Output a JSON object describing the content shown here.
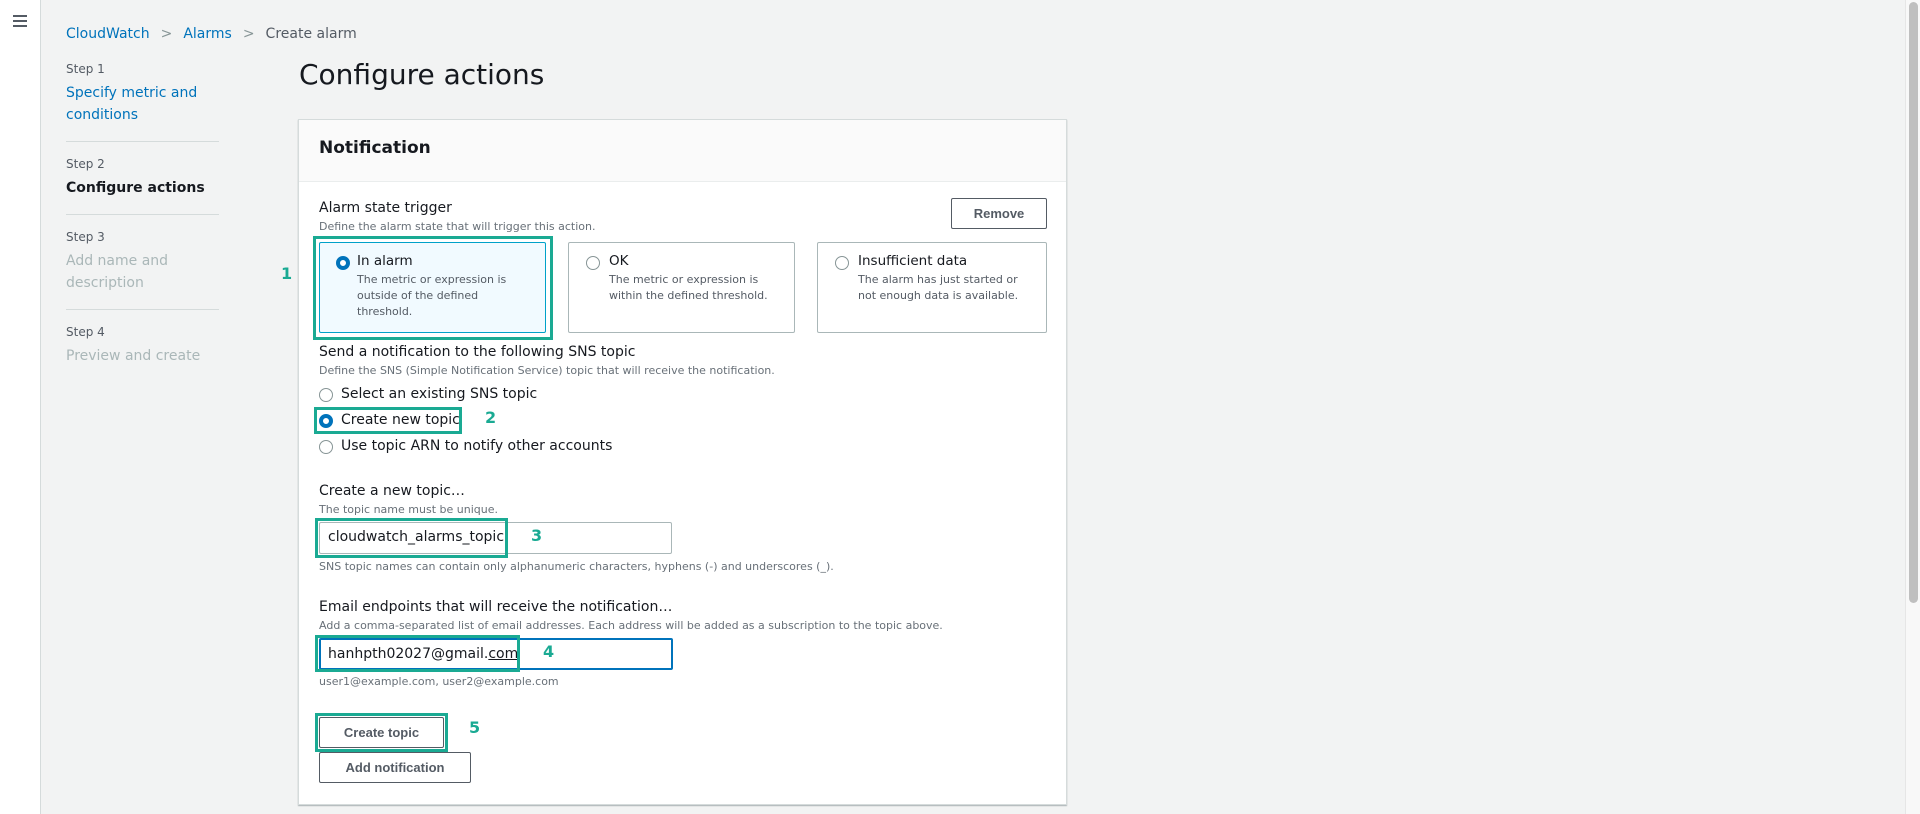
{
  "breadcrumb": [
    {
      "label": "CloudWatch"
    },
    {
      "label": "Alarms"
    },
    {
      "label": "Create alarm"
    }
  ],
  "breadcrumb_separator": ">",
  "steps": [
    {
      "number": "Step 1",
      "title": "Specify metric and conditions",
      "state": "link"
    },
    {
      "number": "Step 2",
      "title": "Configure actions",
      "state": "active"
    },
    {
      "number": "Step 3",
      "title": "Add name and description",
      "state": "disabled"
    },
    {
      "number": "Step 4",
      "title": "Preview and create",
      "state": "disabled"
    }
  ],
  "page_title": "Configure actions",
  "notification": {
    "header": "Notification",
    "remove_label": "Remove",
    "alarm_state": {
      "label": "Alarm state trigger",
      "description": "Define the alarm state that will trigger this action.",
      "options": [
        {
          "label": "In alarm",
          "description": "The metric or expression is outside of the defined threshold.",
          "selected": true
        },
        {
          "label": "OK",
          "description": "The metric or expression is within the defined threshold.",
          "selected": false
        },
        {
          "label": "Insufficient data",
          "description": "The alarm has just started or not enough data is available.",
          "selected": false
        }
      ]
    },
    "sns": {
      "label": "Send a notification to the following SNS topic",
      "description": "Define the SNS (Simple Notification Service) topic that will receive the notification.",
      "options": [
        {
          "label": "Select an existing SNS topic",
          "selected": false
        },
        {
          "label": "Create new topic",
          "selected": true
        },
        {
          "label": "Use topic ARN to notify other accounts",
          "selected": false
        }
      ]
    },
    "new_topic": {
      "label": "Create a new topic…",
      "description": "The topic name must be unique.",
      "value": "cloudwatch_alarms_topic",
      "constraint": "SNS topic names can contain only alphanumeric characters, hyphens (-) and underscores (_)."
    },
    "email": {
      "label": "Email endpoints that will receive the notification…",
      "description": "Add a comma-separated list of email addresses. Each address will be added as a subscription to the topic above.",
      "value_prefix": "hanhpth02027@gmail.",
      "value_suffix": "com",
      "hint": "user1@example.com, user2@example.com"
    },
    "create_topic_label": "Create topic",
    "add_notification_label": "Add notification"
  },
  "annotations": [
    "1",
    "2",
    "3",
    "4",
    "5"
  ],
  "colors": {
    "accent": "#0073bb",
    "annotation": "#1aaa93",
    "disabled": "#aab7b8"
  }
}
